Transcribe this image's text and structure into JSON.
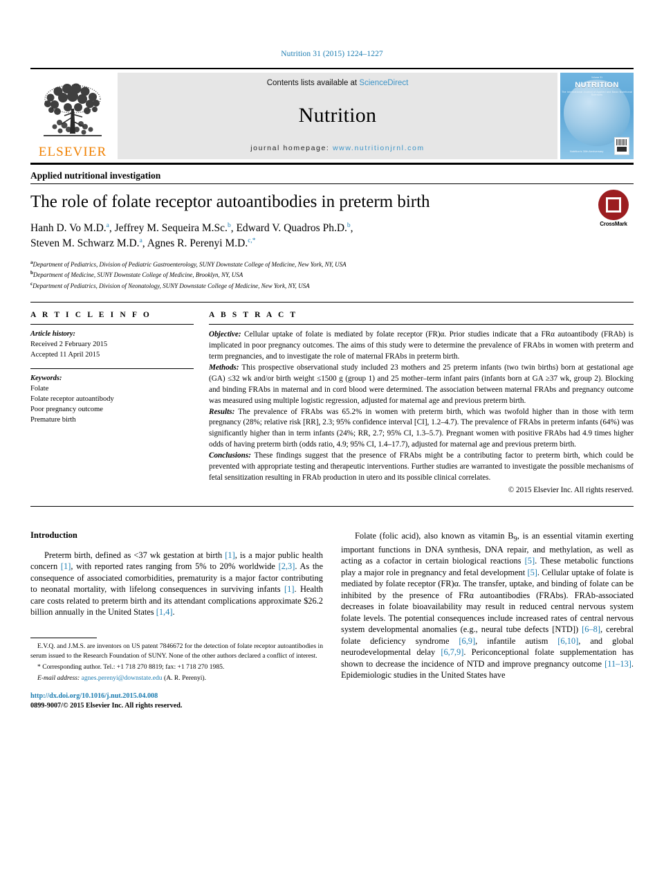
{
  "running_head": "Nutrition 31 (2015) 1224–1227",
  "masthead": {
    "publisher": "ELSEVIER",
    "contents_prefix": "Contents lists available at ",
    "contents_link": "ScienceDirect",
    "journal_title": "Nutrition",
    "homepage_prefix": "journal homepage: ",
    "homepage_url": "www.nutritionjrnl.com",
    "cover": {
      "kicker": "Volume 31",
      "title": "NUTRITION",
      "subtitle": "The International Journal of Applied and Basic Nutritional Sciences",
      "footer": "Nutrition's 30th Anniversary"
    }
  },
  "kicker": "Applied nutritional investigation",
  "article": {
    "title": "The role of folate receptor autoantibodies in preterm birth",
    "authors_line1": "Hanh D. Vo M.D. ",
    "authors": [
      {
        "name": "Hanh D. Vo M.D.",
        "sup": "a",
        "sep": ", "
      },
      {
        "name": "Jeffrey M. Sequeira M.Sc.",
        "sup": "b",
        "sep": ", "
      },
      {
        "name": "Edward V. Quadros Ph.D.",
        "sup": "b",
        "sep": ", "
      },
      {
        "name": "Steven M. Schwarz M.D.",
        "sup": "a",
        "sep": ", "
      },
      {
        "name": "Agnes R. Perenyi M.D.",
        "sup": "c,*",
        "sep": ""
      }
    ],
    "affiliations": [
      {
        "marker": "a",
        "text": "Department of Pediatrics, Division of Pediatric Gastroenterology, SUNY Downstate College of Medicine, New York, NY, USA"
      },
      {
        "marker": "b",
        "text": "Department of Medicine, SUNY Downstate College of Medicine, Brooklyn, NY, USA"
      },
      {
        "marker": "c",
        "text": "Department of Pediatrics, Division of Neonatology, SUNY Downstate College of Medicine, New York, NY, USA"
      }
    ],
    "crossmark_label": "CrossMark"
  },
  "article_info": {
    "heading": "A R T I C L E   I N F O",
    "history_label": "Article history:",
    "history": [
      "Received 2 February 2015",
      "Accepted 11 April 2015"
    ],
    "keywords_label": "Keywords:",
    "keywords": [
      "Folate",
      "Folate receptor autoantibody",
      "Poor pregnancy outcome",
      "Premature birth"
    ]
  },
  "abstract": {
    "heading": "A B S T R A C T",
    "objective_label": "Objective:",
    "objective_text": " Cellular uptake of folate is mediated by folate receptor (FR)α. Prior studies indicate that a FRα autoantibody (FRAb) is implicated in poor pregnancy outcomes. The aims of this study were to determine the prevalence of FRAbs in women with preterm and term pregnancies, and to investigate the role of maternal FRAbs in preterm birth.",
    "methods_label": "Methods:",
    "methods_text": " This prospective observational study included 23 mothers and 25 preterm infants (two twin births) born at gestational age (GA) ≤32 wk and/or birth weight ≤1500 g (group 1) and 25 mother–term infant pairs (infants born at GA ≥37 wk, group 2). Blocking and binding FRAbs in maternal and in cord blood were determined. The association between maternal FRAbs and pregnancy outcome was measured using multiple logistic regression, adjusted for maternal age and previous preterm birth.",
    "results_label": "Results:",
    "results_text": " The prevalence of FRAbs was 65.2% in women with preterm birth, which was twofold higher than in those with term pregnancy (28%; relative risk [RR], 2.3; 95% confidence interval [CI], 1.2–4.7). The prevalence of FRAbs in preterm infants (64%) was significantly higher than in term infants (24%; RR, 2.7; 95% CI, 1.3–5.7). Pregnant women with positive FRAbs had 4.9 times higher odds of having preterm birth (odds ratio, 4.9; 95% CI, 1.4–17.7), adjusted for maternal age and previous preterm birth.",
    "conclusions_label": "Conclusions:",
    "conclusions_text": " These findings suggest that the presence of FRAbs might be a contributing factor to preterm birth, which could be prevented with appropriate testing and therapeutic interventions. Further studies are warranted to investigate the possible mechanisms of fetal sensitization resulting in FRAb production in utero and its possible clinical correlates.",
    "copyright": "© 2015 Elsevier Inc. All rights reserved."
  },
  "introduction": {
    "heading": "Introduction",
    "para1_a": "Preterm birth, defined as <37 wk gestation at birth ",
    "para1_r1": "[1]",
    "para1_b": ", is a major public health concern ",
    "para1_r2": "[1]",
    "para1_c": ", with reported rates ranging from 5% to 20% worldwide ",
    "para1_r3": "[2,3]",
    "para1_d": ". As the consequence of associated comorbidities, prematurity is a major factor contributing to neonatal mortality, with lifelong consequences in surviving infants ",
    "para1_r4": "[1]",
    "para1_e": ". Health care costs related to preterm birth and its attendant complications approximate $26.2 billion annually in the United States ",
    "para1_r5": "[1,4]",
    "para1_f": "."
  },
  "right_column": {
    "para_a": "Folate (folic acid), also known as vitamin B",
    "para_a_sub": "9",
    "para_b": ", is an essential vitamin exerting important functions in DNA synthesis, DNA repair, and methylation, as well as acting as a cofactor in certain biological reactions ",
    "r1": "[5]",
    "para_c": ". These metabolic functions play a major role in pregnancy and fetal development ",
    "r2": "[5]",
    "para_d": ". Cellular uptake of folate is mediated by folate receptor (FR)α. The transfer, uptake, and binding of folate can be inhibited by the presence of FRα autoantibodies (FRAbs). FRAb-associated decreases in folate bioavailability may result in reduced central nervous system folate levels. The potential consequences include increased rates of central nervous system developmental anomalies (e.g., neural tube defects [NTD]) ",
    "r3": "[6–8]",
    "para_e": ", cerebral folate deficiency syndrome ",
    "r4": "[6,9]",
    "para_f": ", infantile autism ",
    "r5": "[6,10]",
    "para_g": ", and global neurodevelopmental delay ",
    "r6": "[6,7,9]",
    "para_h": ". Periconceptional folate supplementation has shown to decrease the incidence of NTD and improve pregnancy outcome ",
    "r7": "[11–13]",
    "para_i": ". Epidemiologic studies in the United States have"
  },
  "footnotes": {
    "patent": "E.V.Q. and J.M.S. are inventors on US patent 7846672 for the detection of folate receptor autoantibodies in serum issued to the Research Foundation of SUNY. None of the other authors declared a conflict of interest.",
    "corresponding": "* Corresponding author. Tel.: +1 718 270 8819; fax: +1 718 270 1985.",
    "email_label": "E-mail address:",
    "email": "agnes.perenyi@downstate.edu",
    "email_suffix": " (A. R. Perenyi)."
  },
  "bottom": {
    "doi": "http://dx.doi.org/10.1016/j.nut.2015.04.008",
    "issn": "0899-9007/© 2015 Elsevier Inc. All rights reserved."
  },
  "colors": {
    "link": "#1a7bb0",
    "elsevier_orange": "#f08000",
    "crossmark_red": "#9b1d20",
    "band_gray": "#e6e6e6"
  }
}
